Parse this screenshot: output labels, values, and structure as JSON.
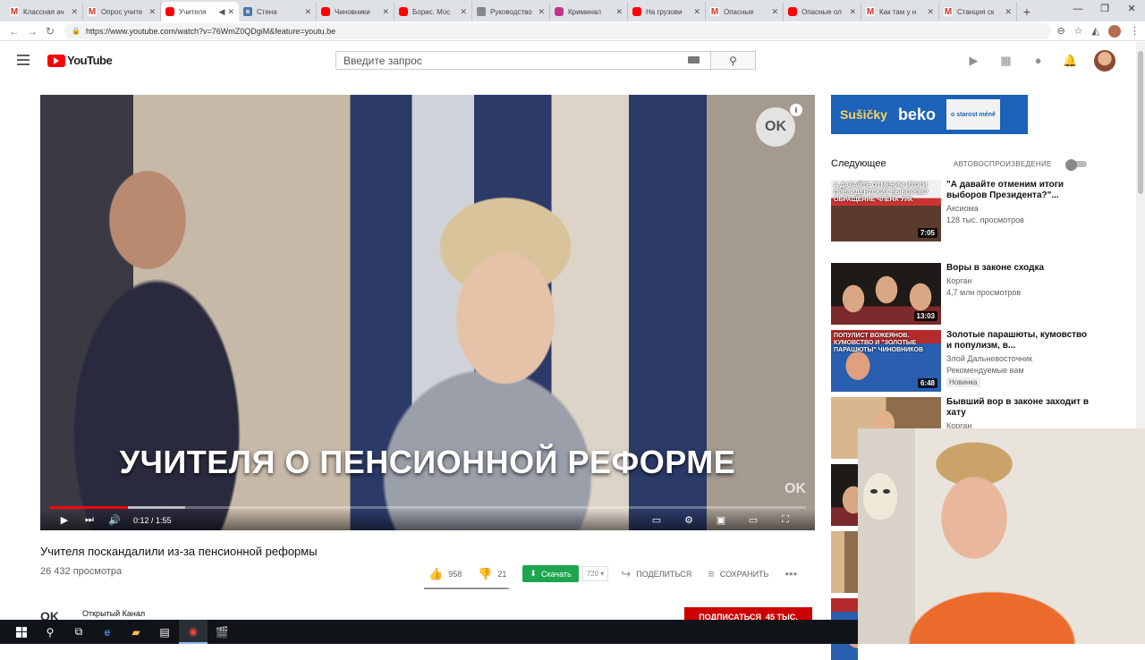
{
  "browser": {
    "tabs": [
      {
        "label": "Классная ач",
        "icon": "gmail-icon",
        "active": false
      },
      {
        "label": "Опрос учите",
        "icon": "gmail-icon",
        "active": false
      },
      {
        "label": "Учителя",
        "icon": "youtube-icon",
        "active": true
      },
      {
        "label": "Стена",
        "icon": "vk-icon",
        "active": false
      },
      {
        "label": "Чиновники",
        "icon": "youtube-icon",
        "active": false
      },
      {
        "label": "Борис. Мос",
        "icon": "youtube-icon",
        "active": false
      },
      {
        "label": "Руководство",
        "icon": "document-icon",
        "active": false
      },
      {
        "label": "Криминал",
        "icon": "instagram-icon",
        "active": false
      },
      {
        "label": "На грузови",
        "icon": "youtube-icon",
        "active": false
      },
      {
        "label": "Опасные",
        "icon": "gmail-icon",
        "active": false
      },
      {
        "label": "Опасные ол",
        "icon": "youtube-icon",
        "active": false
      },
      {
        "label": "Как там у н",
        "icon": "gmail-icon",
        "active": false
      },
      {
        "label": "Станция ск",
        "icon": "gmail-icon",
        "active": false
      }
    ],
    "url": "https://www.youtube.com/watch?v=76WmZ0QDgiM&feature=youtu.be"
  },
  "youtube": {
    "logo_text": "YouTube",
    "search_placeholder": "Введите запрос"
  },
  "player": {
    "caption": "УЧИТЕЛЯ О ПЕНСИОННОЙ РЕФОРМЕ",
    "ok_badge": "OK",
    "watermark": "OK",
    "current_time": "0:12",
    "duration": "1:55",
    "time_display": "0:12 / 1:55",
    "progress_fraction": 0.104
  },
  "video": {
    "title": "Учителя поскандалили из-за пенсионной реформы",
    "views": "26 432 просмотра",
    "likes": "958",
    "dislikes": "21",
    "download_label": "Скачать",
    "quality": "720",
    "share_label": "ПОДЕЛИТЬСЯ",
    "save_label": "СОХРАНИТЬ",
    "channel_name": "Открытый Канал",
    "subscribe_label": "ПОДПИСАТЬСЯ",
    "subscriber_count": "45 ТЫС."
  },
  "sidebar": {
    "ad": {
      "brand1": "Sušičky",
      "brand2": "beko",
      "pack_text": "o starost méně"
    },
    "up_next_label": "Следующее",
    "autoplay_label": "АВТОВОСПРОИЗВЕДЕНИЕ",
    "videos": [
      {
        "title": "\"А давайте отменим итоги выборов Президента?\"...",
        "channel": "Аксиома",
        "meta": "128 тыс. просмотров",
        "duration": "7:05",
        "thumb_text": "А ДАВАЙТЕ ОТМЕНИМ ИТОГИ ПРЕЗИДЕНТСКИХ ВЫБОРОВ? ОБРАЩЕНИЕ ЧЛЕНА УИК"
      },
      {
        "title": "Воры в законе сходка",
        "channel": "Корган",
        "meta": "4,7 млн просмотров",
        "duration": "13:03",
        "thumb_text": ""
      },
      {
        "title": "Золотые парашюты, кумовство и популизм, в...",
        "channel": "Злой Дальневосточник",
        "meta": "Рекомендуемые вам",
        "badge": "Новинка",
        "duration": "6:48",
        "thumb_text": "ПОПУЛИСТ ВОЖЕЯНОВ. КУМОВСТВО И \"ЗОЛОТЫЕ ПАРАШЮТЫ\" ЧИНОВНИКОВ"
      },
      {
        "title": "Бывший вор в законе заходит в хату",
        "channel": "Корган",
        "meta": "",
        "duration": "",
        "thumb_text": ""
      }
    ]
  },
  "colors": {
    "youtube_red": "#ff0000",
    "download_green": "#1ea54f",
    "subscribe_red": "#cc0000",
    "taskbar": "#101418"
  }
}
